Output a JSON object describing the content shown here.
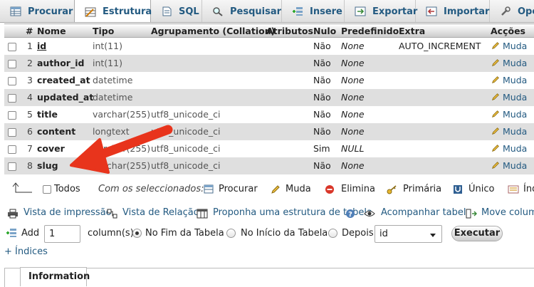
{
  "tabs": [
    {
      "label": "Procurar",
      "icon": "browse-icon"
    },
    {
      "label": "Estrutura",
      "icon": "structure-icon"
    },
    {
      "label": "SQL",
      "icon": "sql-icon"
    },
    {
      "label": "Pesquisar",
      "icon": "search-icon"
    },
    {
      "label": "Insere",
      "icon": "insert-icon"
    },
    {
      "label": "Exportar",
      "icon": "export-icon"
    },
    {
      "label": "Importar",
      "icon": "import-icon"
    },
    {
      "label": "Oper",
      "icon": "operations-icon"
    }
  ],
  "columns": [
    "#",
    "Nome",
    "Tipo",
    "Agrupamento (Collation)",
    "Atributos",
    "Nulo",
    "Predefinido",
    "Extra",
    "Acções"
  ],
  "rows": [
    {
      "n": "1",
      "name": "id",
      "type": "int(11)",
      "collation": "",
      "null": "Não",
      "default": "None",
      "extra": "AUTO_INCREMENT",
      "action": "Muda"
    },
    {
      "n": "2",
      "name": "author_id",
      "type": "int(11)",
      "collation": "",
      "null": "Não",
      "default": "None",
      "extra": "",
      "action": "Muda"
    },
    {
      "n": "3",
      "name": "created_at",
      "type": "datetime",
      "collation": "",
      "null": "Não",
      "default": "None",
      "extra": "",
      "action": "Muda"
    },
    {
      "n": "4",
      "name": "updated_at",
      "type": "datetime",
      "collation": "",
      "null": "Não",
      "default": "None",
      "extra": "",
      "action": "Muda"
    },
    {
      "n": "5",
      "name": "title",
      "type": "varchar(255)",
      "collation": "utf8_unicode_ci",
      "null": "Não",
      "default": "None",
      "extra": "",
      "action": "Muda"
    },
    {
      "n": "6",
      "name": "content",
      "type": "longtext",
      "collation": "utf8_unicode_ci",
      "null": "Não",
      "default": "None",
      "extra": "",
      "action": "Muda"
    },
    {
      "n": "7",
      "name": "cover",
      "type": "varchar(255)",
      "collation": "utf8_unicode_ci",
      "null": "Sim",
      "default": "NULL",
      "extra": "",
      "action": "Muda"
    },
    {
      "n": "8",
      "name": "slug",
      "type": "varchar(255)",
      "collation": "utf8_unicode_ci",
      "null": "Não",
      "default": "None",
      "extra": "",
      "action": "Muda"
    }
  ],
  "selection": {
    "all_label": "Todos",
    "with_selected": "Com os seleccionados:",
    "browse": "Procurar",
    "change": "Muda",
    "drop": "Elimina",
    "primary": "Primária",
    "unique": "Único",
    "index": "Índ"
  },
  "links": {
    "print": "Vista de impressão",
    "relation": "Vista de Relação",
    "propose": "Proponha uma estrutura de tabela",
    "track": "Acompanhar tabela",
    "move": "Move colum"
  },
  "add": {
    "label": "Add",
    "count": "1",
    "columns_label": "column(s)",
    "end": "No Fim da Tabela",
    "start": "No Início da Tabela",
    "after": "Depois",
    "after_field": "id",
    "execute": "Executar"
  },
  "indexes_link": "+ Índices",
  "information_tab": "Information",
  "colors": {
    "link": "#235a81",
    "arrow": "#e8341c",
    "row_alt": "#dfdfdf"
  }
}
